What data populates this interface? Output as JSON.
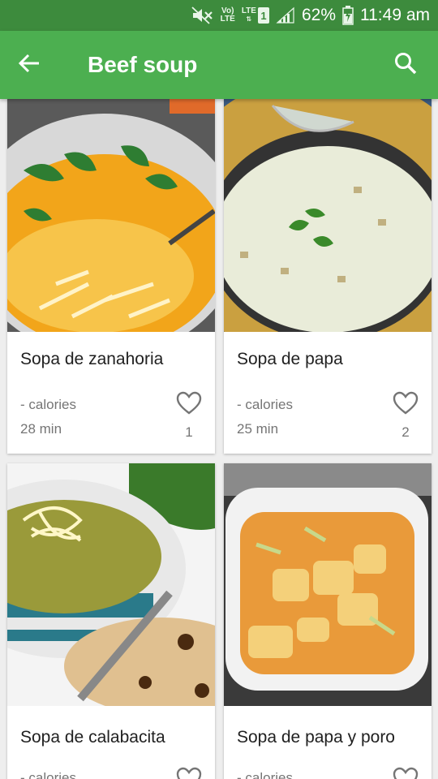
{
  "status_bar": {
    "volte_label_top": "Vo)",
    "volte_label_bottom": "LTE",
    "lte_label": "LTE",
    "sim_number": "1",
    "battery": "62%",
    "time": "11:49 am",
    "icons": [
      "mute-icon",
      "volte-icon",
      "lte-icon",
      "signal-icon",
      "battery-icon"
    ]
  },
  "app_bar": {
    "title": "Beef soup",
    "background": "#4caf50",
    "status_background": "#3d8b3d",
    "back_icon": "arrow-back-icon",
    "search_icon": "search-icon"
  },
  "recipes": [
    {
      "title": "Sopa de zanahoria",
      "calories": "- calories",
      "time": "28 min",
      "likes": "1"
    },
    {
      "title": "Sopa de papa",
      "calories": "- calories",
      "time": "25 min",
      "likes": "2"
    },
    {
      "title": "Sopa de calabacita",
      "calories": "- calories",
      "time": "",
      "likes": ""
    },
    {
      "title": "Sopa de papa y poro",
      "calories": "- calories",
      "time": "",
      "likes": ""
    }
  ]
}
